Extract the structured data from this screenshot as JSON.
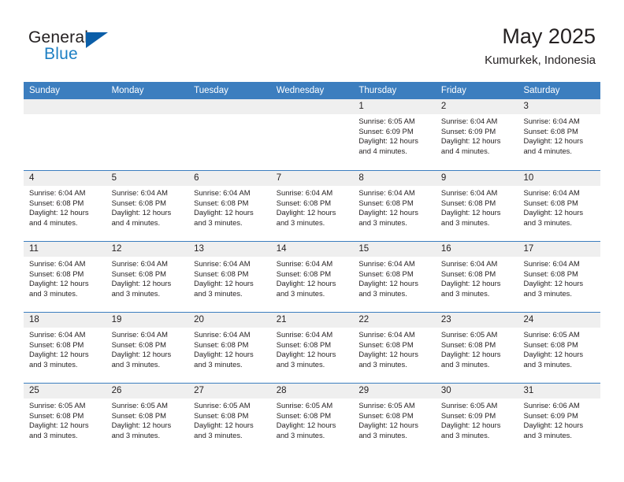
{
  "brand": {
    "word1": "General",
    "word2": "Blue",
    "logo_icon": "triangle-logo-icon"
  },
  "header": {
    "title": "May 2025",
    "subtitle": "Kumurkek, Indonesia"
  },
  "calendar": {
    "weekday_headers": [
      "Sunday",
      "Monday",
      "Tuesday",
      "Wednesday",
      "Thursday",
      "Friday",
      "Saturday"
    ],
    "colors": {
      "header_blue": "#3c7ebf",
      "day_strip_gray": "#efefef",
      "brand_blue": "#1d7fc3",
      "logo_blue": "#0b5ea8",
      "text": "#231f20"
    },
    "weeks": [
      [
        {
          "day": "",
          "lines": []
        },
        {
          "day": "",
          "lines": []
        },
        {
          "day": "",
          "lines": []
        },
        {
          "day": "",
          "lines": []
        },
        {
          "day": "1",
          "lines": [
            "Sunrise: 6:05 AM",
            "Sunset: 6:09 PM",
            "Daylight: 12 hours",
            "and 4 minutes."
          ]
        },
        {
          "day": "2",
          "lines": [
            "Sunrise: 6:04 AM",
            "Sunset: 6:09 PM",
            "Daylight: 12 hours",
            "and 4 minutes."
          ]
        },
        {
          "day": "3",
          "lines": [
            "Sunrise: 6:04 AM",
            "Sunset: 6:08 PM",
            "Daylight: 12 hours",
            "and 4 minutes."
          ]
        }
      ],
      [
        {
          "day": "4",
          "lines": [
            "Sunrise: 6:04 AM",
            "Sunset: 6:08 PM",
            "Daylight: 12 hours",
            "and 4 minutes."
          ]
        },
        {
          "day": "5",
          "lines": [
            "Sunrise: 6:04 AM",
            "Sunset: 6:08 PM",
            "Daylight: 12 hours",
            "and 4 minutes."
          ]
        },
        {
          "day": "6",
          "lines": [
            "Sunrise: 6:04 AM",
            "Sunset: 6:08 PM",
            "Daylight: 12 hours",
            "and 3 minutes."
          ]
        },
        {
          "day": "7",
          "lines": [
            "Sunrise: 6:04 AM",
            "Sunset: 6:08 PM",
            "Daylight: 12 hours",
            "and 3 minutes."
          ]
        },
        {
          "day": "8",
          "lines": [
            "Sunrise: 6:04 AM",
            "Sunset: 6:08 PM",
            "Daylight: 12 hours",
            "and 3 minutes."
          ]
        },
        {
          "day": "9",
          "lines": [
            "Sunrise: 6:04 AM",
            "Sunset: 6:08 PM",
            "Daylight: 12 hours",
            "and 3 minutes."
          ]
        },
        {
          "day": "10",
          "lines": [
            "Sunrise: 6:04 AM",
            "Sunset: 6:08 PM",
            "Daylight: 12 hours",
            "and 3 minutes."
          ]
        }
      ],
      [
        {
          "day": "11",
          "lines": [
            "Sunrise: 6:04 AM",
            "Sunset: 6:08 PM",
            "Daylight: 12 hours",
            "and 3 minutes."
          ]
        },
        {
          "day": "12",
          "lines": [
            "Sunrise: 6:04 AM",
            "Sunset: 6:08 PM",
            "Daylight: 12 hours",
            "and 3 minutes."
          ]
        },
        {
          "day": "13",
          "lines": [
            "Sunrise: 6:04 AM",
            "Sunset: 6:08 PM",
            "Daylight: 12 hours",
            "and 3 minutes."
          ]
        },
        {
          "day": "14",
          "lines": [
            "Sunrise: 6:04 AM",
            "Sunset: 6:08 PM",
            "Daylight: 12 hours",
            "and 3 minutes."
          ]
        },
        {
          "day": "15",
          "lines": [
            "Sunrise: 6:04 AM",
            "Sunset: 6:08 PM",
            "Daylight: 12 hours",
            "and 3 minutes."
          ]
        },
        {
          "day": "16",
          "lines": [
            "Sunrise: 6:04 AM",
            "Sunset: 6:08 PM",
            "Daylight: 12 hours",
            "and 3 minutes."
          ]
        },
        {
          "day": "17",
          "lines": [
            "Sunrise: 6:04 AM",
            "Sunset: 6:08 PM",
            "Daylight: 12 hours",
            "and 3 minutes."
          ]
        }
      ],
      [
        {
          "day": "18",
          "lines": [
            "Sunrise: 6:04 AM",
            "Sunset: 6:08 PM",
            "Daylight: 12 hours",
            "and 3 minutes."
          ]
        },
        {
          "day": "19",
          "lines": [
            "Sunrise: 6:04 AM",
            "Sunset: 6:08 PM",
            "Daylight: 12 hours",
            "and 3 minutes."
          ]
        },
        {
          "day": "20",
          "lines": [
            "Sunrise: 6:04 AM",
            "Sunset: 6:08 PM",
            "Daylight: 12 hours",
            "and 3 minutes."
          ]
        },
        {
          "day": "21",
          "lines": [
            "Sunrise: 6:04 AM",
            "Sunset: 6:08 PM",
            "Daylight: 12 hours",
            "and 3 minutes."
          ]
        },
        {
          "day": "22",
          "lines": [
            "Sunrise: 6:04 AM",
            "Sunset: 6:08 PM",
            "Daylight: 12 hours",
            "and 3 minutes."
          ]
        },
        {
          "day": "23",
          "lines": [
            "Sunrise: 6:05 AM",
            "Sunset: 6:08 PM",
            "Daylight: 12 hours",
            "and 3 minutes."
          ]
        },
        {
          "day": "24",
          "lines": [
            "Sunrise: 6:05 AM",
            "Sunset: 6:08 PM",
            "Daylight: 12 hours",
            "and 3 minutes."
          ]
        }
      ],
      [
        {
          "day": "25",
          "lines": [
            "Sunrise: 6:05 AM",
            "Sunset: 6:08 PM",
            "Daylight: 12 hours",
            "and 3 minutes."
          ]
        },
        {
          "day": "26",
          "lines": [
            "Sunrise: 6:05 AM",
            "Sunset: 6:08 PM",
            "Daylight: 12 hours",
            "and 3 minutes."
          ]
        },
        {
          "day": "27",
          "lines": [
            "Sunrise: 6:05 AM",
            "Sunset: 6:08 PM",
            "Daylight: 12 hours",
            "and 3 minutes."
          ]
        },
        {
          "day": "28",
          "lines": [
            "Sunrise: 6:05 AM",
            "Sunset: 6:08 PM",
            "Daylight: 12 hours",
            "and 3 minutes."
          ]
        },
        {
          "day": "29",
          "lines": [
            "Sunrise: 6:05 AM",
            "Sunset: 6:08 PM",
            "Daylight: 12 hours",
            "and 3 minutes."
          ]
        },
        {
          "day": "30",
          "lines": [
            "Sunrise: 6:05 AM",
            "Sunset: 6:09 PM",
            "Daylight: 12 hours",
            "and 3 minutes."
          ]
        },
        {
          "day": "31",
          "lines": [
            "Sunrise: 6:06 AM",
            "Sunset: 6:09 PM",
            "Daylight: 12 hours",
            "and 3 minutes."
          ]
        }
      ]
    ]
  }
}
